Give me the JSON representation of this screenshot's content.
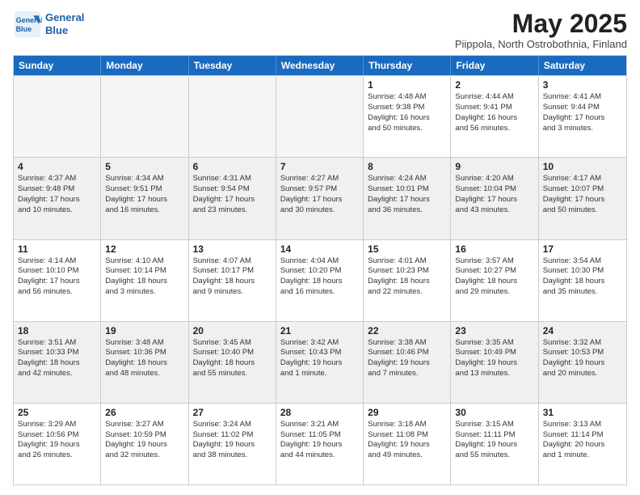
{
  "logo": {
    "line1": "General",
    "line2": "Blue"
  },
  "title": "May 2025",
  "subtitle": "Piippola, North Ostrobothnia, Finland",
  "headers": [
    "Sunday",
    "Monday",
    "Tuesday",
    "Wednesday",
    "Thursday",
    "Friday",
    "Saturday"
  ],
  "rows": [
    [
      {
        "day": "",
        "info": "",
        "empty": true
      },
      {
        "day": "",
        "info": "",
        "empty": true
      },
      {
        "day": "",
        "info": "",
        "empty": true
      },
      {
        "day": "",
        "info": "",
        "empty": true
      },
      {
        "day": "1",
        "info": "Sunrise: 4:48 AM\nSunset: 9:38 PM\nDaylight: 16 hours\nand 50 minutes."
      },
      {
        "day": "2",
        "info": "Sunrise: 4:44 AM\nSunset: 9:41 PM\nDaylight: 16 hours\nand 56 minutes."
      },
      {
        "day": "3",
        "info": "Sunrise: 4:41 AM\nSunset: 9:44 PM\nDaylight: 17 hours\nand 3 minutes."
      }
    ],
    [
      {
        "day": "4",
        "info": "Sunrise: 4:37 AM\nSunset: 9:48 PM\nDaylight: 17 hours\nand 10 minutes."
      },
      {
        "day": "5",
        "info": "Sunrise: 4:34 AM\nSunset: 9:51 PM\nDaylight: 17 hours\nand 16 minutes."
      },
      {
        "day": "6",
        "info": "Sunrise: 4:31 AM\nSunset: 9:54 PM\nDaylight: 17 hours\nand 23 minutes."
      },
      {
        "day": "7",
        "info": "Sunrise: 4:27 AM\nSunset: 9:57 PM\nDaylight: 17 hours\nand 30 minutes."
      },
      {
        "day": "8",
        "info": "Sunrise: 4:24 AM\nSunset: 10:01 PM\nDaylight: 17 hours\nand 36 minutes."
      },
      {
        "day": "9",
        "info": "Sunrise: 4:20 AM\nSunset: 10:04 PM\nDaylight: 17 hours\nand 43 minutes."
      },
      {
        "day": "10",
        "info": "Sunrise: 4:17 AM\nSunset: 10:07 PM\nDaylight: 17 hours\nand 50 minutes."
      }
    ],
    [
      {
        "day": "11",
        "info": "Sunrise: 4:14 AM\nSunset: 10:10 PM\nDaylight: 17 hours\nand 56 minutes."
      },
      {
        "day": "12",
        "info": "Sunrise: 4:10 AM\nSunset: 10:14 PM\nDaylight: 18 hours\nand 3 minutes."
      },
      {
        "day": "13",
        "info": "Sunrise: 4:07 AM\nSunset: 10:17 PM\nDaylight: 18 hours\nand 9 minutes."
      },
      {
        "day": "14",
        "info": "Sunrise: 4:04 AM\nSunset: 10:20 PM\nDaylight: 18 hours\nand 16 minutes."
      },
      {
        "day": "15",
        "info": "Sunrise: 4:01 AM\nSunset: 10:23 PM\nDaylight: 18 hours\nand 22 minutes."
      },
      {
        "day": "16",
        "info": "Sunrise: 3:57 AM\nSunset: 10:27 PM\nDaylight: 18 hours\nand 29 minutes."
      },
      {
        "day": "17",
        "info": "Sunrise: 3:54 AM\nSunset: 10:30 PM\nDaylight: 18 hours\nand 35 minutes."
      }
    ],
    [
      {
        "day": "18",
        "info": "Sunrise: 3:51 AM\nSunset: 10:33 PM\nDaylight: 18 hours\nand 42 minutes."
      },
      {
        "day": "19",
        "info": "Sunrise: 3:48 AM\nSunset: 10:36 PM\nDaylight: 18 hours\nand 48 minutes."
      },
      {
        "day": "20",
        "info": "Sunrise: 3:45 AM\nSunset: 10:40 PM\nDaylight: 18 hours\nand 55 minutes."
      },
      {
        "day": "21",
        "info": "Sunrise: 3:42 AM\nSunset: 10:43 PM\nDaylight: 19 hours\nand 1 minute."
      },
      {
        "day": "22",
        "info": "Sunrise: 3:38 AM\nSunset: 10:46 PM\nDaylight: 19 hours\nand 7 minutes."
      },
      {
        "day": "23",
        "info": "Sunrise: 3:35 AM\nSunset: 10:49 PM\nDaylight: 19 hours\nand 13 minutes."
      },
      {
        "day": "24",
        "info": "Sunrise: 3:32 AM\nSunset: 10:53 PM\nDaylight: 19 hours\nand 20 minutes."
      }
    ],
    [
      {
        "day": "25",
        "info": "Sunrise: 3:29 AM\nSunset: 10:56 PM\nDaylight: 19 hours\nand 26 minutes."
      },
      {
        "day": "26",
        "info": "Sunrise: 3:27 AM\nSunset: 10:59 PM\nDaylight: 19 hours\nand 32 minutes."
      },
      {
        "day": "27",
        "info": "Sunrise: 3:24 AM\nSunset: 11:02 PM\nDaylight: 19 hours\nand 38 minutes."
      },
      {
        "day": "28",
        "info": "Sunrise: 3:21 AM\nSunset: 11:05 PM\nDaylight: 19 hours\nand 44 minutes."
      },
      {
        "day": "29",
        "info": "Sunrise: 3:18 AM\nSunset: 11:08 PM\nDaylight: 19 hours\nand 49 minutes."
      },
      {
        "day": "30",
        "info": "Sunrise: 3:15 AM\nSunset: 11:11 PM\nDaylight: 19 hours\nand 55 minutes."
      },
      {
        "day": "31",
        "info": "Sunrise: 3:13 AM\nSunset: 11:14 PM\nDaylight: 20 hours\nand 1 minute."
      }
    ]
  ]
}
